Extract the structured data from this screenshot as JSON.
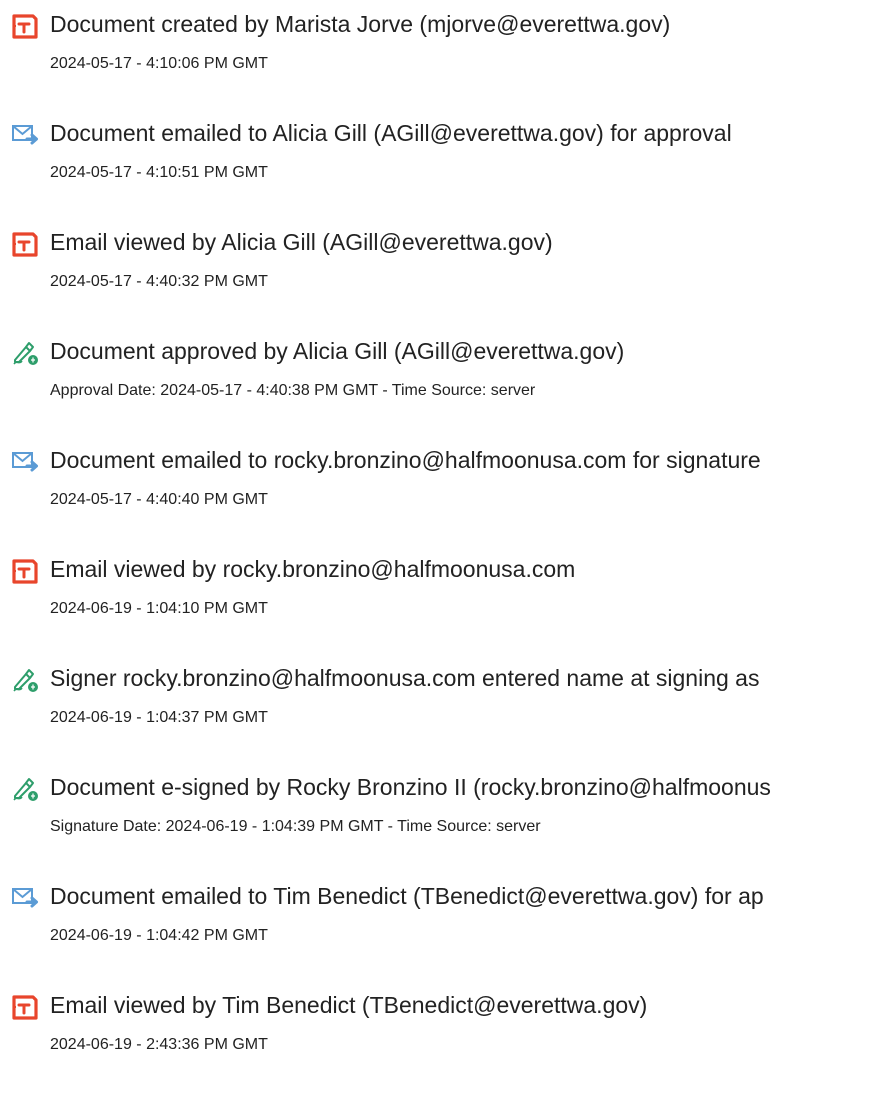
{
  "events": [
    {
      "icon": "acrobat-document-icon",
      "title": "Document created by Marista Jorve (mjorve@everettwa.gov)",
      "sub": "2024-05-17 - 4:10:06 PM GMT"
    },
    {
      "icon": "email-sent-icon",
      "title": "Document emailed to Alicia Gill (AGill@everettwa.gov) for approval",
      "sub": "2024-05-17 - 4:10:51 PM GMT"
    },
    {
      "icon": "acrobat-document-icon",
      "title": "Email viewed by Alicia Gill (AGill@everettwa.gov)",
      "sub": "2024-05-17 - 4:40:32 PM GMT"
    },
    {
      "icon": "pen-signature-icon",
      "title": "Document approved by Alicia Gill (AGill@everettwa.gov)",
      "sub": "Approval Date: 2024-05-17 - 4:40:38 PM GMT - Time Source: server"
    },
    {
      "icon": "email-sent-icon",
      "title": "Document emailed to rocky.bronzino@halfmoonusa.com for signature",
      "sub": "2024-05-17 - 4:40:40 PM GMT"
    },
    {
      "icon": "acrobat-document-icon",
      "title": "Email viewed by rocky.bronzino@halfmoonusa.com",
      "sub": "2024-06-19 - 1:04:10 PM GMT"
    },
    {
      "icon": "pen-signature-icon",
      "title": "Signer rocky.bronzino@halfmoonusa.com entered name at signing as",
      "sub": "2024-06-19 - 1:04:37 PM GMT"
    },
    {
      "icon": "pen-signature-icon",
      "title": "Document e-signed by Rocky Bronzino II (rocky.bronzino@halfmoonus",
      "sub": "Signature Date: 2024-06-19 - 1:04:39 PM GMT - Time Source: server"
    },
    {
      "icon": "email-sent-icon",
      "title": "Document emailed to Tim Benedict (TBenedict@everettwa.gov) for ap",
      "sub": "2024-06-19 - 1:04:42 PM GMT"
    },
    {
      "icon": "acrobat-document-icon",
      "title": "Email viewed by Tim Benedict (TBenedict@everettwa.gov)",
      "sub": "2024-06-19 - 2:43:36 PM GMT"
    }
  ],
  "colors": {
    "acrobat_red": "#e8452c",
    "email_blue": "#5b9bd5",
    "signature_green": "#2e9e6b",
    "text": "#222222"
  }
}
